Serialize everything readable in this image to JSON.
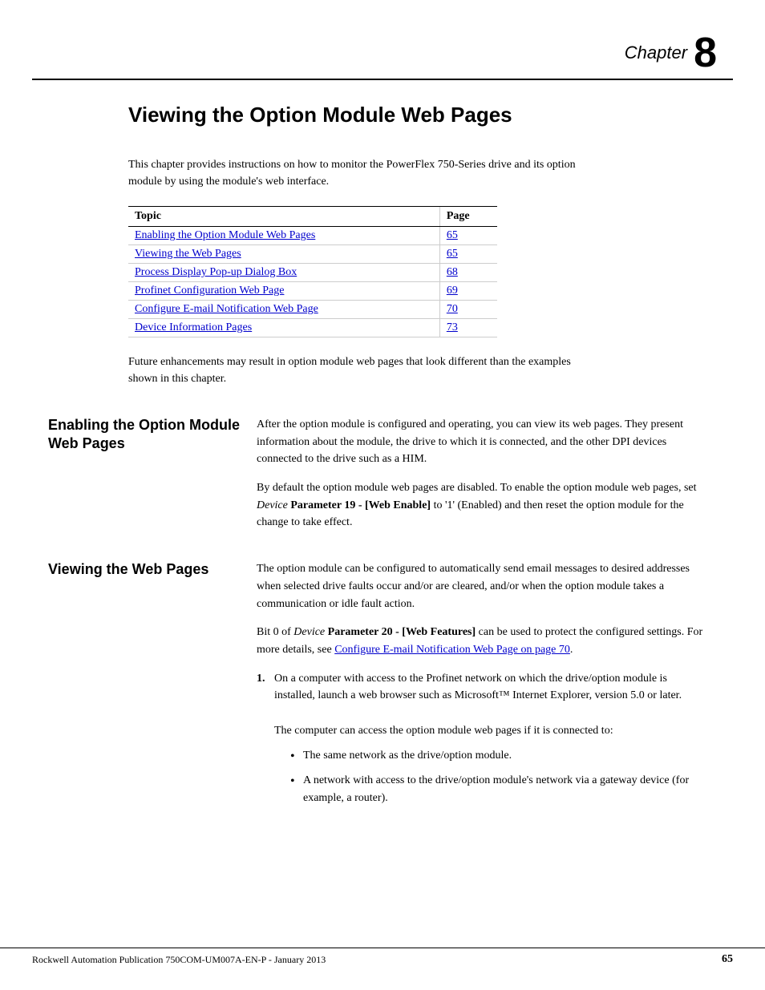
{
  "chapter": {
    "label": "Chapter",
    "number": "8"
  },
  "page_title": "Viewing the Option Module Web Pages",
  "intro": {
    "text": "This chapter provides instructions on how to monitor the PowerFlex 750-Series drive and its option module by using the module's web interface."
  },
  "toc": {
    "col_topic": "Topic",
    "col_page": "Page",
    "rows": [
      {
        "topic": "Enabling the Option Module Web Pages",
        "page": "65"
      },
      {
        "topic": "Viewing the Web Pages",
        "page": "65"
      },
      {
        "topic": "Process Display Pop-up Dialog Box",
        "page": "68"
      },
      {
        "topic": "Profinet Configuration Web Page",
        "page": "69"
      },
      {
        "topic": "Configure E-mail Notification Web Page",
        "page": "70"
      },
      {
        "topic": "Device Information Pages",
        "page": "73"
      }
    ]
  },
  "future_text": "Future enhancements may result in option module web pages that look different than the examples shown in this chapter.",
  "sections": [
    {
      "id": "enabling",
      "heading_line1": "Enabling the Option Module",
      "heading_line2": "Web Pages",
      "paragraphs": [
        "After the option module is configured and operating, you can view its web pages. They present information about the module, the drive to which it is connected, and the other DPI devices connected to the drive such as a HIM.",
        "By default the option module web pages are disabled. To enable the option module web pages, set Device Parameter 19 - [Web Enable] to '1' (Enabled) and then reset the option module for the change to take effect."
      ],
      "paragraphs_formatted": [
        {
          "parts": [
            {
              "text": "After the option module is configured and operating, you can view its web pages. They present information about the module, the drive to which it is connected, and the other DPI devices connected to the drive such as a HIM.",
              "bold": false,
              "italic": false
            }
          ]
        },
        {
          "parts": [
            {
              "text": "By default the option module web pages are disabled. To enable the option module web pages, set ",
              "bold": false,
              "italic": false
            },
            {
              "text": "Device",
              "bold": false,
              "italic": true
            },
            {
              "text": " ",
              "bold": false,
              "italic": false
            },
            {
              "text": "Parameter 19 - [Web Enable]",
              "bold": true,
              "italic": false
            },
            {
              "text": " to '1' (Enabled) and then reset the option module for the change to take effect.",
              "bold": false,
              "italic": false
            }
          ]
        }
      ]
    },
    {
      "id": "viewing",
      "heading_line1": "Viewing the Web Pages",
      "heading_line2": "",
      "paragraphs_formatted": [
        {
          "parts": [
            {
              "text": "The option module can be configured to automatically send email messages to desired addresses when selected drive faults occur and/or  are cleared, and/or when the option module takes a communication or idle fault action.",
              "bold": false,
              "italic": false
            }
          ]
        },
        {
          "parts": [
            {
              "text": "Bit 0 of ",
              "bold": false,
              "italic": false
            },
            {
              "text": "Device",
              "bold": false,
              "italic": true
            },
            {
              "text": " ",
              "bold": false,
              "italic": false
            },
            {
              "text": "Parameter 20 - [Web Features]",
              "bold": true,
              "italic": false
            },
            {
              "text": " can be used to protect the configured settings. For more details, see ",
              "bold": false,
              "italic": false
            },
            {
              "text": "Configure E-mail Notification Web Page on page 70",
              "bold": false,
              "italic": false,
              "link": true
            },
            {
              "text": ".",
              "bold": false,
              "italic": false
            }
          ]
        }
      ],
      "numbered_items": [
        {
          "number": "1.",
          "text": "On a computer with access to the Profinet network on which the drive/option module is installed, launch a web browser such as Microsoft™ Internet Explorer, version 5.0 or later.",
          "sub_text": "The computer can access the option module web pages if it is connected to:",
          "bullets": [
            "The same network as the drive/option module.",
            "A network with access to the drive/option module's network via a gateway device (for example, a router)."
          ]
        }
      ]
    }
  ],
  "footer": {
    "publication": "Rockwell Automation Publication 750COM-UM007A-EN-P - January 2013",
    "page": "65"
  }
}
